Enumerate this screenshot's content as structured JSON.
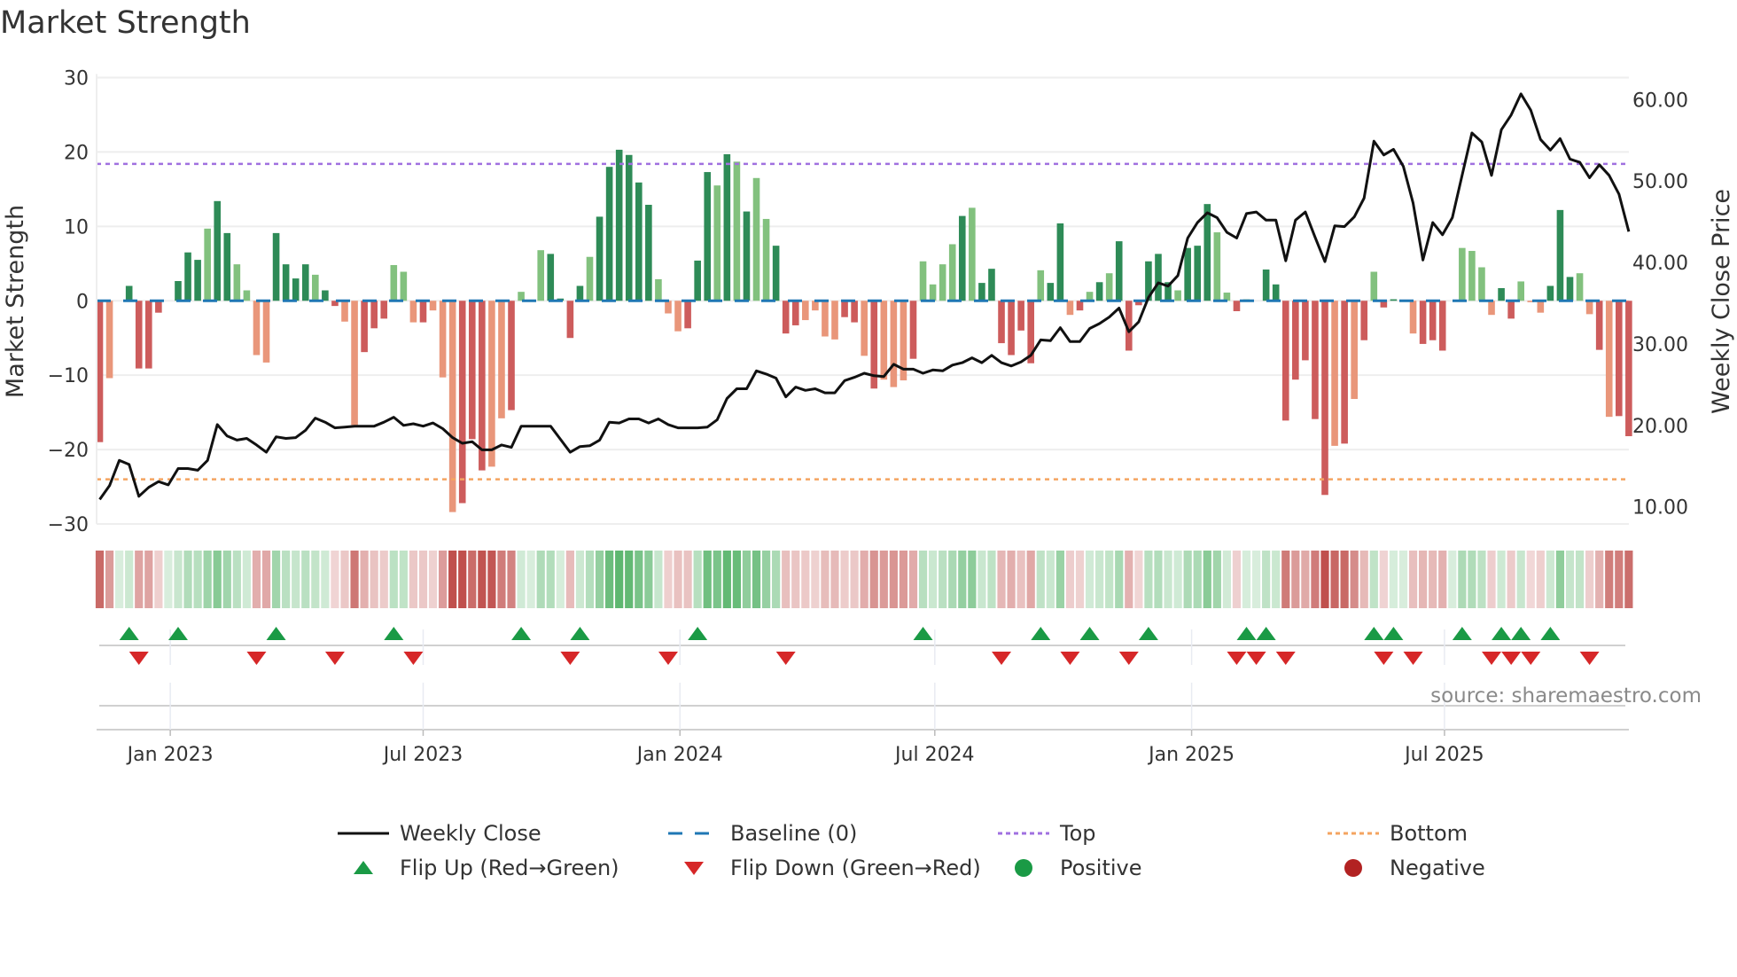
{
  "title": "Market Strength",
  "source": "source: sharemaestro.com",
  "colors": {
    "pos_dark": "#2e8b57",
    "pos_light": "#82c17e",
    "neg_dark": "#cd5c5c",
    "neg_light": "#e9967a",
    "line": "#111111",
    "baseline": "#1f77b4",
    "top": "#a070e0",
    "bottom": "#f4a460",
    "flip_up": "#1a9a45",
    "flip_down": "#d62728",
    "positive": "#1a9a45",
    "negative": "#b22222"
  },
  "legend": [
    {
      "label": "Weekly Close",
      "kind": "line"
    },
    {
      "label": "Baseline (0)",
      "kind": "baseline"
    },
    {
      "label": "Top",
      "kind": "top"
    },
    {
      "label": "Bottom",
      "kind": "bottom"
    },
    {
      "label": "Flip Up (Red→Green)",
      "kind": "flip_up"
    },
    {
      "label": "Flip Down (Green→Red)",
      "kind": "flip_down"
    },
    {
      "label": "Positive",
      "kind": "positive"
    },
    {
      "label": "Negative",
      "kind": "negative"
    }
  ],
  "chart_data": {
    "type": "bar",
    "title": "Market Strength",
    "ylabel": "Market Strength",
    "y2label": "Weekly Close Price",
    "ylim": [
      -30,
      30
    ],
    "y2lim": [
      7.9,
      62.7
    ],
    "yticks": [
      "30",
      "20",
      "10",
      "0",
      "−10",
      "−20",
      "−30"
    ],
    "ytick_values": [
      30,
      20,
      10,
      0,
      -10,
      -20,
      -30
    ],
    "y2ticks": [
      "60.00",
      "50.00",
      "40.00",
      "30.00",
      "20.00",
      "10.00"
    ],
    "y2tick_values": [
      60,
      50,
      40,
      30,
      20,
      10
    ],
    "xticks": [
      {
        "label": "Jan 2023",
        "week": 7.2
      },
      {
        "label": "Jul 2023",
        "week": 33.0
      },
      {
        "label": "Jan 2024",
        "week": 59.2
      },
      {
        "label": "Jul 2024",
        "week": 85.2
      },
      {
        "label": "Jan 2025",
        "week": 111.4
      },
      {
        "label": "Jul 2025",
        "week": 137.2
      }
    ],
    "top_level": 18.4,
    "bottom_level": -24.0,
    "baseline": 0,
    "strength": [
      -19,
      -10.4,
      0,
      2.0,
      -9.1,
      -9.1,
      -1.6,
      0,
      2.65,
      6.5,
      5.5,
      9.7,
      13.4,
      9.1,
      4.9,
      1.4,
      -7.3,
      -8.3,
      9.1,
      4.9,
      3.0,
      4.9,
      3.5,
      1.4,
      -0.7,
      -2.8,
      -16.7,
      -6.9,
      -3.7,
      -2.4,
      4.8,
      3.9,
      -2.9,
      -2.9,
      -1.3,
      -10.3,
      -28.4,
      -27.2,
      -18.6,
      -22.8,
      -22.3,
      -15.8,
      -14.7,
      1.2,
      0,
      6.8,
      6.3,
      0.3,
      -5.0,
      2.0,
      5.9,
      11.3,
      18.0,
      20.3,
      19.6,
      15.9,
      12.9,
      2.9,
      -1.7,
      -4.1,
      -3.7,
      5.4,
      17.3,
      15.5,
      19.7,
      18.7,
      12.0,
      16.5,
      11.0,
      7.4,
      -4.4,
      -3.3,
      -2.6,
      -1.3,
      -4.8,
      -5.2,
      -2.2,
      -2.9,
      -7.4,
      -11.8,
      -10.6,
      -11.6,
      -10.7,
      -7.8,
      5.3,
      2.2,
      4.9,
      7.6,
      11.4,
      12.5,
      2.4,
      4.3,
      -5.7,
      -7.3,
      -4.0,
      -8.4,
      4.1,
      2.4,
      10.4,
      -1.9,
      -1.3,
      1.2,
      2.5,
      3.7,
      8.0,
      -6.7,
      -0.6,
      5.3,
      6.3,
      2.5,
      1.4,
      7.1,
      7.4,
      13.0,
      9.2,
      1.1,
      -1.4,
      0.2,
      0,
      4.2,
      2.2,
      -16.1,
      -10.6,
      -8.0,
      -15.9,
      -26.1,
      -19.5,
      -19.2,
      -13.2,
      -5.3,
      3.9,
      -0.9,
      0.2,
      0,
      -4.4,
      -5.8,
      -5.3,
      -6.7,
      0,
      7.1,
      6.7,
      4.5,
      -1.9,
      1.7,
      -2.4,
      2.6,
      -0.2,
      -1.6,
      2.0,
      12.2,
      3.2,
      3.7,
      -1.8,
      -6.6,
      -15.6,
      -15.5,
      -18.2
    ],
    "shade": "dldddddddddlddllllddddlddlldddllldllldddlldlllddddlddddddllldddldldlldddllllddldllldlllldlddddddlddldldlddddddldddlldlldddddddldldlddlldddlllllddllldddlldlddldllddddldddldldddddddldd",
    "weekly_close": [
      10.9,
      12.6,
      15.7,
      15.2,
      11.3,
      12.4,
      13.1,
      12.7,
      14.7,
      14.7,
      14.5,
      15.7,
      20.1,
      18.7,
      18.2,
      18.4,
      17.6,
      16.7,
      18.6,
      18.4,
      18.5,
      19.4,
      20.9,
      20.4,
      19.7,
      19.8,
      19.9,
      19.9,
      19.9,
      20.4,
      21.0,
      20.0,
      20.2,
      19.9,
      20.3,
      19.6,
      18.5,
      17.8,
      18.0,
      17.0,
      17.0,
      17.6,
      17.3,
      19.9,
      19.9,
      19.9,
      19.9,
      18.3,
      16.7,
      17.4,
      17.5,
      18.2,
      20.4,
      20.3,
      20.8,
      20.8,
      20.3,
      20.8,
      20.1,
      19.7,
      19.7,
      19.7,
      19.8,
      20.7,
      23.3,
      24.5,
      24.5,
      26.7,
      26.3,
      25.8,
      23.5,
      24.7,
      24.3,
      24.5,
      24.0,
      24.0,
      25.5,
      25.9,
      26.4,
      26.1,
      26.0,
      27.5,
      26.9,
      26.9,
      26.4,
      26.8,
      26.7,
      27.4,
      27.7,
      28.3,
      27.7,
      28.6,
      27.7,
      27.3,
      27.8,
      28.6,
      30.5,
      30.4,
      32.0,
      30.3,
      30.3,
      31.9,
      32.5,
      33.3,
      34.4,
      31.5,
      32.7,
      35.7,
      37.5,
      37.1,
      38.4,
      43.0,
      44.9,
      46.1,
      45.5,
      43.7,
      43.0,
      46.0,
      46.2,
      45.2,
      45.2,
      40.2,
      45.2,
      46.2,
      43.1,
      40.1,
      44.5,
      44.4,
      45.6,
      47.9,
      54.9,
      53.2,
      53.9,
      51.8,
      47.3,
      40.3,
      44.9,
      43.4,
      45.5,
      50.7,
      55.9,
      54.8,
      50.7,
      56.3,
      58.1,
      60.7,
      58.7,
      55.1,
      53.8,
      55.2,
      52.7,
      52.3,
      50.4,
      52.0,
      50.7,
      48.4,
      43.8
    ],
    "flip_up_weeks": [
      3,
      8,
      18,
      30,
      43,
      49,
      61,
      84,
      96,
      101,
      107,
      117,
      119,
      130,
      132,
      139,
      143,
      145,
      148
    ],
    "flip_down_weeks": [
      4,
      16,
      24,
      32,
      48,
      58,
      70,
      92,
      99,
      105,
      116,
      118,
      121,
      131,
      134,
      142,
      144,
      146,
      152
    ],
    "legend_position": "bottom"
  }
}
